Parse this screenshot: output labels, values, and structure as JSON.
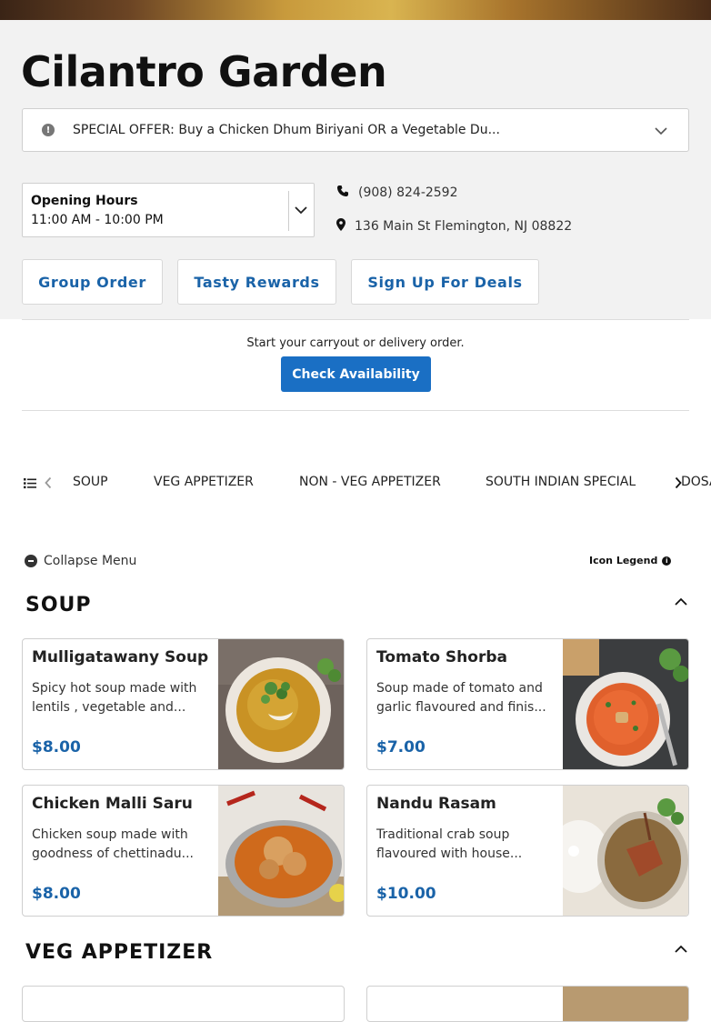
{
  "restaurant": {
    "name": "Cilantro Garden",
    "special_offer": "SPECIAL OFFER: Buy a Chicken Dhum Biriyani OR a Vegetable Du...",
    "hours_label": "Opening Hours",
    "hours_value": "11:00 AM - 10:00 PM",
    "phone": "(908) 824-2592",
    "address": "136 Main St Flemington, NJ 08822"
  },
  "actions": {
    "group_order": "Group Order",
    "tasty_rewards": "Tasty Rewards",
    "sign_up": "Sign Up For Deals"
  },
  "availability": {
    "prompt": "Start your carryout or delivery order.",
    "button": "Check Availability"
  },
  "category_nav": {
    "items": [
      "SOUP",
      "VEG APPETIZER",
      "NON - VEG APPETIZER",
      "SOUTH INDIAN SPECIAL",
      "DOSA"
    ]
  },
  "menu_controls": {
    "collapse_label": "Collapse Menu",
    "legend_label": "Icon Legend"
  },
  "sections": [
    {
      "title": "SOUP",
      "items": [
        {
          "name": "Mulligatawany Soup",
          "desc_line1": "Spicy hot soup made with",
          "desc_line2": "lentils , vegetable and...",
          "price": "$8.00"
        },
        {
          "name": "Tomato Shorba",
          "desc_line1": "Soup made of tomato and",
          "desc_line2": "garlic flavoured and finis...",
          "price": "$7.00"
        },
        {
          "name": "Chicken Malli Saru",
          "desc_line1": "Chicken soup made with",
          "desc_line2": "goodness of chettinadu...",
          "price": "$8.00"
        },
        {
          "name": "Nandu Rasam",
          "desc_line1": "Traditional crab soup",
          "desc_line2": "flavoured with house...",
          "price": "$10.00"
        }
      ]
    },
    {
      "title": "VEG APPETIZER",
      "items": []
    }
  ],
  "colors": {
    "accent_blue": "#1a63a8",
    "button_blue": "#1a6fc4",
    "top_background": "#f2f2f2"
  },
  "icons": [
    "info-icon",
    "chevron-down-icon",
    "phone-icon",
    "map-pin-icon",
    "list-icon",
    "chevron-left-icon",
    "chevron-right-icon",
    "minus-circle-icon",
    "chevron-up-icon"
  ]
}
